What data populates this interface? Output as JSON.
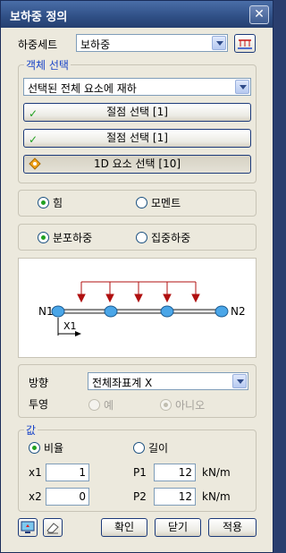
{
  "window": {
    "title": "보하중 정의",
    "close_glyph": "✕"
  },
  "load_set": {
    "label": "하중세트",
    "value": "보하중"
  },
  "object_selection": {
    "title": "객체 선택",
    "mode": "선택된 전체 요소에 재하",
    "buttons": [
      "절점 선택 [1]",
      "절점 선택 [1]",
      "1D 요소 선택 [10]"
    ]
  },
  "force_type": {
    "options": [
      "힘",
      "모멘트"
    ],
    "selected": "힘"
  },
  "load_type": {
    "options": [
      "분포하중",
      "집중하중"
    ],
    "selected": "분포하중"
  },
  "diagram": {
    "n1": "N1",
    "n2": "N2",
    "x1": "X1"
  },
  "direction": {
    "label": "방향",
    "value": "전체좌표계 X"
  },
  "projection": {
    "label": "투영",
    "yes": "예",
    "no": "아니오",
    "selected": "아니오"
  },
  "values": {
    "title": "값",
    "ratio_label": "비율",
    "length_label": "길이",
    "selected": "비율",
    "x1": {
      "label": "x1",
      "value": "1"
    },
    "x2": {
      "label": "x2",
      "value": "0"
    },
    "p1": {
      "label": "P1",
      "value": "12",
      "unit": "kN/m"
    },
    "p2": {
      "label": "P2",
      "value": "12",
      "unit": "kN/m"
    }
  },
  "footer": {
    "ok": "확인",
    "close": "닫기",
    "apply": "적용"
  },
  "colors": {
    "accent_blue": "#1a45c8",
    "check_green": "#21a121",
    "arrow_red": "#b01010",
    "node_blue": "#4aa6e8"
  }
}
